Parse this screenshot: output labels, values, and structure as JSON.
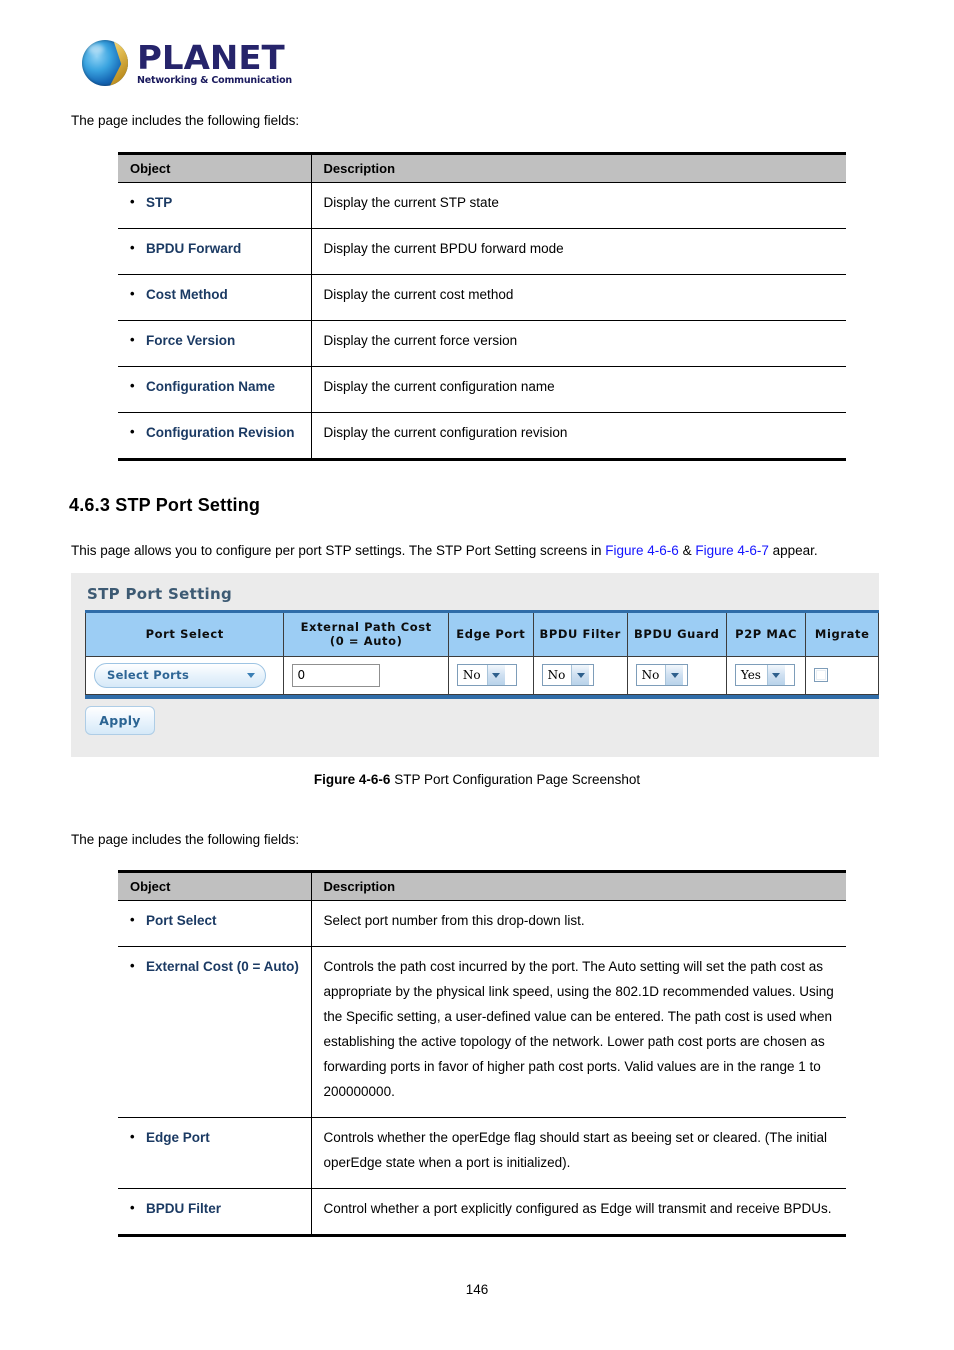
{
  "brand": {
    "name": "PLANET",
    "tagline": "Networking & Communication",
    "logo_icon": "planet-sphere-icon",
    "word_color": "#26246B"
  },
  "intro_text_1": "The page includes the following fields:",
  "intro_text_2": "The page includes the following fields:",
  "section": {
    "heading": "4.6.3 STP Port Setting",
    "lead_before": "This page allows you to configure per port STP settings. The STP Port Setting screens in ",
    "lead_link_1": "Figure 4-6-6",
    "lead_amp": " & ",
    "lead_link_2": "Figure 4-6-7",
    "lead_after": " appear.",
    "link_color": "#1414FF"
  },
  "table1": {
    "headers": [
      "Object",
      "Description"
    ],
    "rows": [
      {
        "object": "STP",
        "description": "Display the current STP state"
      },
      {
        "object": "BPDU Forward",
        "description": "Display the current BPDU forward mode"
      },
      {
        "object": "Cost Method",
        "description": "Display the current cost method"
      },
      {
        "object": "Force Version",
        "description": "Display the current force version"
      },
      {
        "object": "Configuration Name",
        "description": "Display the current configuration name"
      },
      {
        "object": "Configuration Revision",
        "description": "Display the current configuration revision"
      }
    ]
  },
  "widget": {
    "title": "STP Port Setting",
    "headers": {
      "port_select": "Port Select",
      "external_path_cost_line1": "External Path Cost",
      "external_path_cost_line2": "(0 = Auto)",
      "edge_port": "Edge Port",
      "bpdu_filter": "BPDU Filter",
      "bpdu_guard": "BPDU Guard",
      "p2p_mac": "P2P MAC",
      "migrate": "Migrate"
    },
    "values": {
      "port_select": "Select Ports",
      "external_path_cost": "0",
      "edge_port": "No",
      "bpdu_filter": "No",
      "bpdu_guard": "No",
      "p2p_mac": "Yes",
      "migrate_checked": false
    },
    "apply_label": "Apply",
    "header_bg": "#9CCDF4",
    "panel_bg": "#EBEBEB",
    "accent": "#2F6CA8"
  },
  "figure_caption": {
    "label": "Figure 4-6-6",
    "text": " STP Port Configuration Page Screenshot"
  },
  "table2": {
    "headers": [
      "Object",
      "Description"
    ],
    "rows": [
      {
        "object": "Port Select",
        "description": "Select port number from this drop-down list."
      },
      {
        "object": "External Cost (0 = Auto)",
        "description": "Controls the path cost incurred by the port. The Auto setting will set the path cost as appropriate by the physical link speed, using the 802.1D recommended values. Using the Specific setting, a user-defined value can be entered. The path cost is used when establishing the active topology of the network. Lower path cost ports are chosen as forwarding ports in favor of higher path cost ports. Valid values are in the range 1 to 200000000."
      },
      {
        "object": "Edge Port",
        "description": "Controls whether the operEdge flag should start as beeing set or cleared. (The initial operEdge state when a port is initialized)."
      },
      {
        "object": "BPDU Filter",
        "description": "Control whether a port explicitly configured as Edge will transmit and receive BPDUs."
      }
    ]
  },
  "page_number": "146"
}
